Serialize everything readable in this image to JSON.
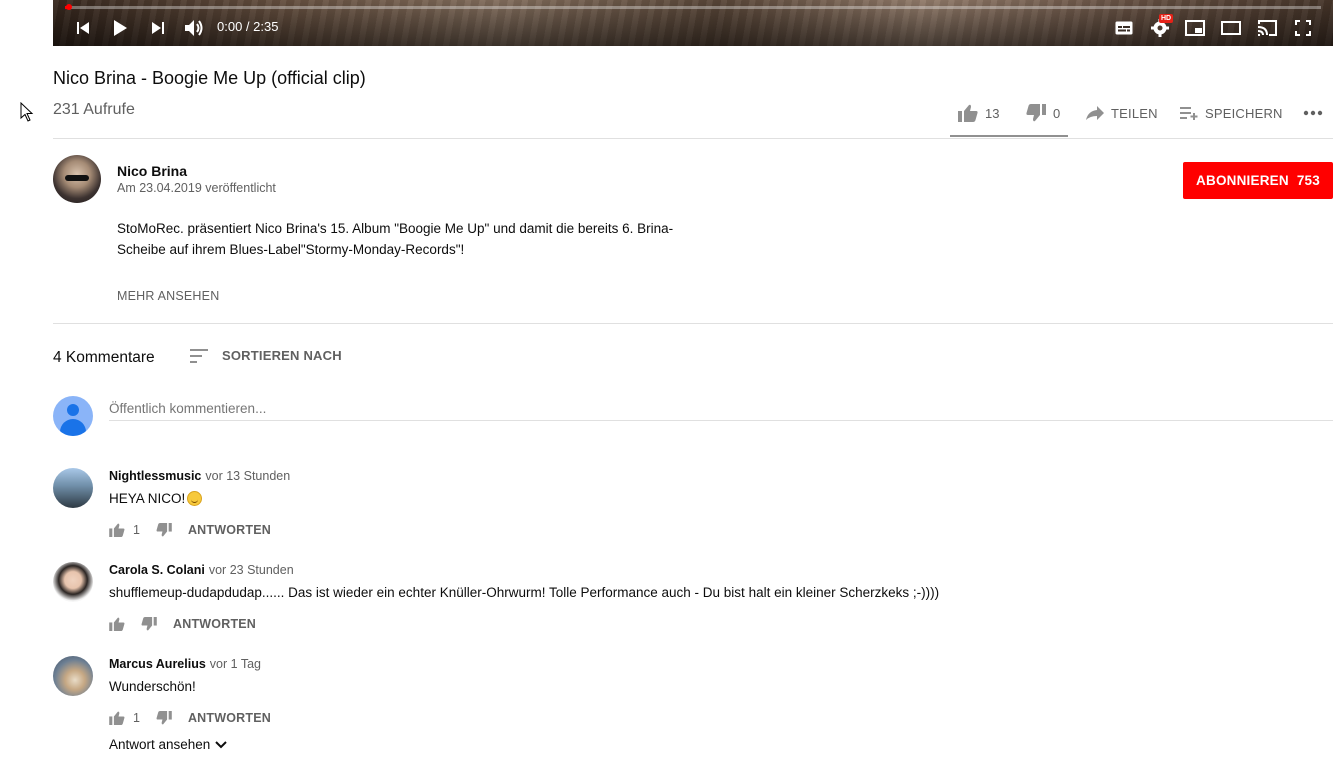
{
  "player": {
    "time": "0:00 / 2:35",
    "progress_fraction": 0.0
  },
  "video": {
    "title": "Nico Brina - Boogie Me Up (official clip)",
    "views": "231 Aufrufe",
    "likes": "13",
    "dislikes": "0",
    "share_label": "TEILEN",
    "save_label": "SPEICHERN"
  },
  "channel": {
    "name": "Nico Brina",
    "published": "Am 23.04.2019 veröffentlicht",
    "subscribe_label": "ABONNIEREN",
    "subscriber_count": "753",
    "description": "StoMoRec. präsentiert Nico Brina's 15. Album \"Boogie Me Up\" und damit die bereits 6. Brina-Scheibe auf ihrem Blues-Label\"Stormy-Monday-Records\"!",
    "more_label": "MEHR ANSEHEN"
  },
  "comments_section": {
    "count_label": "4 Kommentare",
    "sort_label": "SORTIEREN NACH",
    "input_placeholder": "Öffentlich kommentieren..."
  },
  "comments": [
    {
      "author": "Nightlessmusic",
      "time": "vor 13 Stunden",
      "text": "HEYA NICO!",
      "likes": "1",
      "reply_label": "ANTWORTEN"
    },
    {
      "author": "Carola S. Colani",
      "time": "vor 23 Stunden",
      "text": "shufflemeup-dudapdudap...... Das ist wieder ein echter Knüller-Ohrwurm! Tolle Performance auch - Du bist halt ein kleiner Scherzkeks ;-))))",
      "likes": "",
      "reply_label": "ANTWORTEN"
    },
    {
      "author": "Marcus Aurelius",
      "time": "vor 1 Tag",
      "text": "Wunderschön!",
      "likes": "1",
      "reply_label": "ANTWORTEN",
      "view_replies_label": "Antwort ansehen"
    }
  ],
  "colors": {
    "accent_red": "#ff0000",
    "secondary_text": "#606060"
  }
}
